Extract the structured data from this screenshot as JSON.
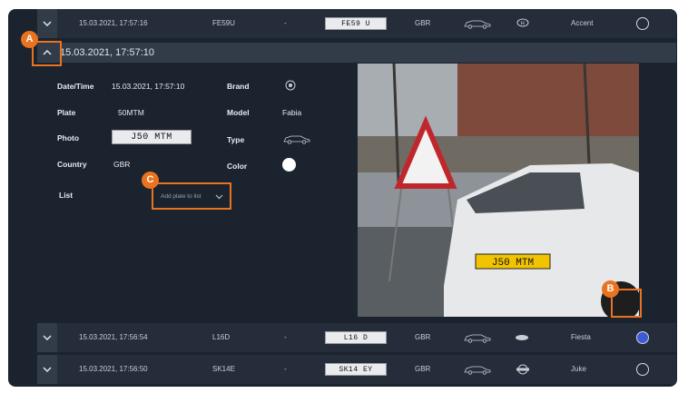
{
  "rows_top": [
    {
      "datetime": "15.03.2021, 17:57:16",
      "plate": "FE59U",
      "dash": "-",
      "plate_img": "FE59 U",
      "country": "GBR",
      "model": "Accent"
    }
  ],
  "expanded": {
    "title": "15.03.2021, 17:57:10",
    "labels": {
      "datetime": "Date/Time",
      "plate": "Plate",
      "photo": "Photo",
      "country": "Country",
      "list": "List",
      "brand": "Brand",
      "model": "Model",
      "type": "Type",
      "color": "Color"
    },
    "values": {
      "datetime": "15.03.2021, 17:57:10",
      "plate": "50MTM",
      "photo_plate": "J50 MTM",
      "country": "GBR",
      "model": "Fabia"
    },
    "list_placeholder": "Add plate to list",
    "scene_plate": "J50 MTM"
  },
  "rows_bottom": [
    {
      "datetime": "15.03.2021, 17:56:54",
      "plate": "L16D",
      "dash": "-",
      "plate_img": "L16 D",
      "country": "GBR",
      "model": "Fiesta"
    },
    {
      "datetime": "15.03.2021, 17:56:50",
      "plate": "SK14E",
      "dash": "-",
      "plate_img": "SK14 EY",
      "country": "GBR",
      "model": "Juke"
    }
  ],
  "callouts": {
    "a": "A",
    "b": "B",
    "c": "C"
  },
  "colors": {
    "accent": "#ea7320",
    "row_bg": "#242d39",
    "fiesta_color": "#3d5bd6"
  }
}
